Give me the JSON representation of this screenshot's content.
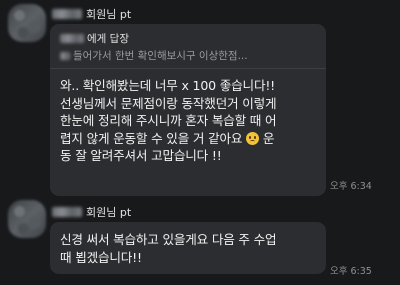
{
  "messages": [
    {
      "sender_suffix": "회원님 pt",
      "reply_label": "에게 답장",
      "reply_quote": "들어가서 한번 확인해보시구 이상한점...",
      "body": "와.. 확인해봤는데 너무 x 100 좋습니다!!\n선생님께서 문제점이랑 동작했던거 이렇게\n한눈에 정리해 주시니까 혼자 복습할 때 어\n렵지 않게 운동할 수 있을 거 같아요 ",
      "body_after_emoji": " 운\n동 잘 알려주셔서 고맙습니다 !!",
      "time": "오후 6:34",
      "emoji_icon": "pleading-face-emoji"
    },
    {
      "sender_suffix": "회원님 pt",
      "body": "신경 써서 복습하고 있을게요 다음 주 수업\n때 뵙겠습니다!!",
      "time": "오후 6:35"
    }
  ]
}
